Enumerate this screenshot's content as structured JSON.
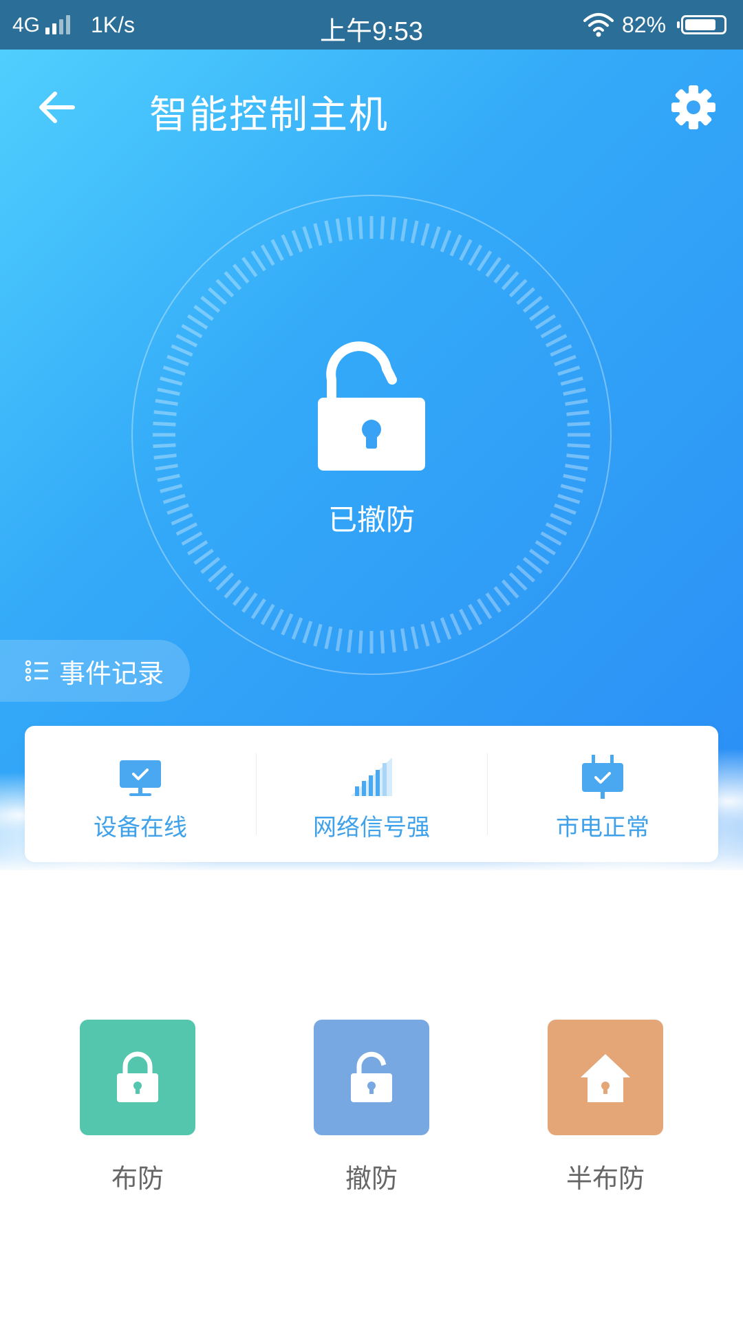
{
  "status_bar": {
    "network": "4G",
    "speed": "1K/s",
    "time": "上午9:53",
    "battery_percent": "82%",
    "battery_level": 0.82
  },
  "header": {
    "title": "智能控制主机",
    "back_icon": "arrow-left-icon",
    "settings_icon": "gear-icon"
  },
  "dial": {
    "state_label": "已撤防",
    "state_icon": "unlocked-padlock-icon"
  },
  "event_record": {
    "label": "事件记录",
    "icon": "list-icon"
  },
  "status_items": [
    {
      "label": "设备在线",
      "icon": "monitor-check-icon"
    },
    {
      "label": "网络信号强",
      "icon": "signal-bars-icon"
    },
    {
      "label": "市电正常",
      "icon": "power-plug-check-icon"
    }
  ],
  "actions": [
    {
      "label": "布防",
      "icon": "locked-padlock-icon",
      "color": "#54c6ae"
    },
    {
      "label": "撤防",
      "icon": "unlocked-padlock-icon",
      "color": "#78a8e2"
    },
    {
      "label": "半布防",
      "icon": "home-lock-icon",
      "color": "#e4a676"
    }
  ],
  "colors": {
    "hero_gradient_start": "#52d2fe",
    "hero_gradient_end": "#2a8df5",
    "status_bar": "#2b6f98",
    "status_text": "#3ea1ea",
    "action_label": "#666666"
  }
}
